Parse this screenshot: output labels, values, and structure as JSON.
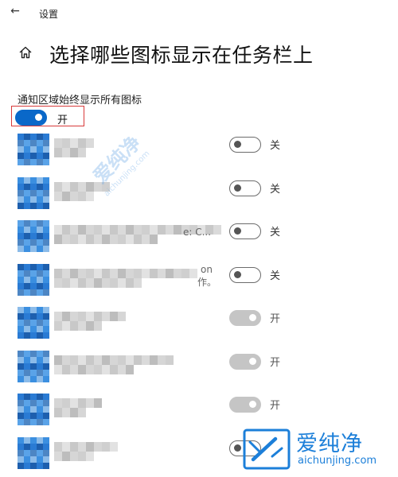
{
  "window": {
    "back_glyph": "←",
    "app_title": "设置"
  },
  "header": {
    "title": "选择哪些图标显示在任务栏上",
    "icon": "home-icon"
  },
  "always_show": {
    "label": "通知区域始终显示所有图标",
    "state": "开",
    "on": true
  },
  "rows": [
    {
      "state": "关",
      "tail": ""
    },
    {
      "state": "关",
      "tail": ""
    },
    {
      "state": "关",
      "tail": "e: C..."
    },
    {
      "state": "关",
      "tail": "on",
      "tail2": "作。"
    },
    {
      "state": "开",
      "tail": ""
    },
    {
      "state": "开",
      "tail": ""
    },
    {
      "state": "开",
      "tail": ""
    },
    {
      "state": "",
      "tail": ""
    }
  ],
  "watermark": {
    "brand": "爱纯净",
    "url": "aichunjing.com"
  },
  "colors": {
    "accent": "#0a68c9",
    "highlight_border": "#d83a3a",
    "watermark": "#1c7fd9"
  }
}
